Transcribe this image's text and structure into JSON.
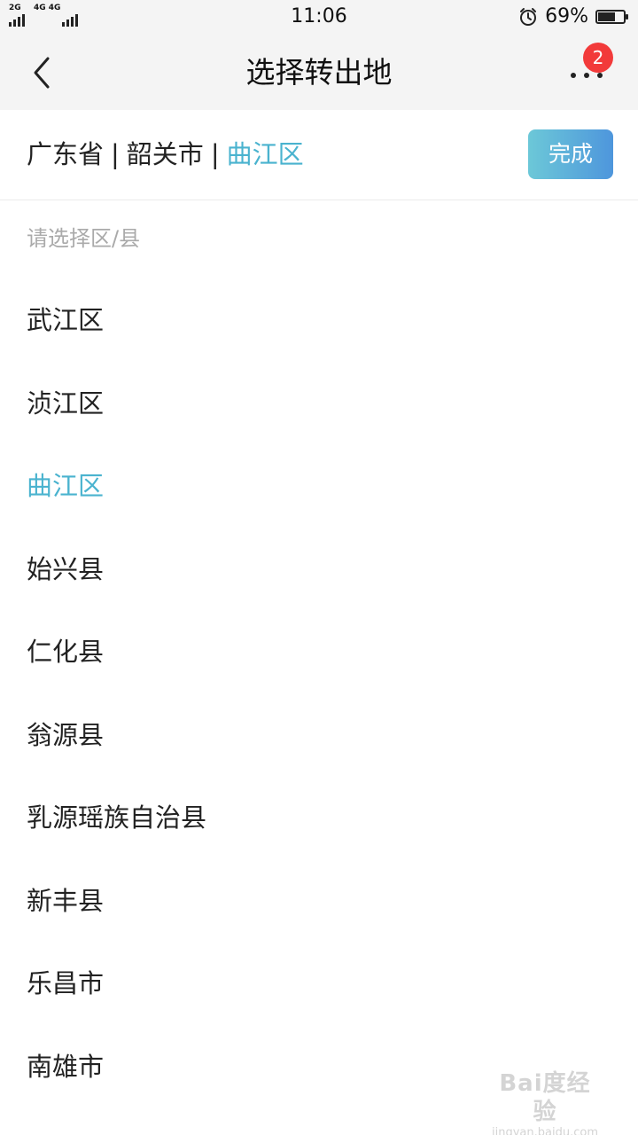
{
  "status_bar": {
    "sim1_label": "2G",
    "sim2_label": "4G 4G",
    "time": "11:06",
    "alarm_icon": "alarm-clock-icon",
    "battery_percent_text": "69%",
    "battery_level": 0.69
  },
  "header": {
    "back_icon": "chevron-left-icon",
    "title": "选择转出地",
    "more_icon": "more-dots-icon",
    "badge_count": "2"
  },
  "breadcrumb": {
    "province": "广东省",
    "separator": "|",
    "city": "韶关市",
    "district": "曲江区",
    "done_label": "完成"
  },
  "list": {
    "hint": "请选择区/县",
    "items": [
      {
        "label": "武江区",
        "selected": false
      },
      {
        "label": "浈江区",
        "selected": false
      },
      {
        "label": "曲江区",
        "selected": true
      },
      {
        "label": "始兴县",
        "selected": false
      },
      {
        "label": "仁化县",
        "selected": false
      },
      {
        "label": "翁源县",
        "selected": false
      },
      {
        "label": "乳源瑶族自治县",
        "selected": false
      },
      {
        "label": "新丰县",
        "selected": false
      },
      {
        "label": "乐昌市",
        "selected": false
      },
      {
        "label": "南雄市",
        "selected": false
      }
    ]
  },
  "watermark": {
    "main": "Bai度经验",
    "sub": "jingyan.baidu.com"
  },
  "colors": {
    "accent": "#4ab3cf",
    "badge": "#f23a3a",
    "button_gradient_start": "#6cc8d8",
    "button_gradient_end": "#4e96dc",
    "hint_text": "#aaaaaa",
    "header_bg": "#f4f4f4"
  }
}
